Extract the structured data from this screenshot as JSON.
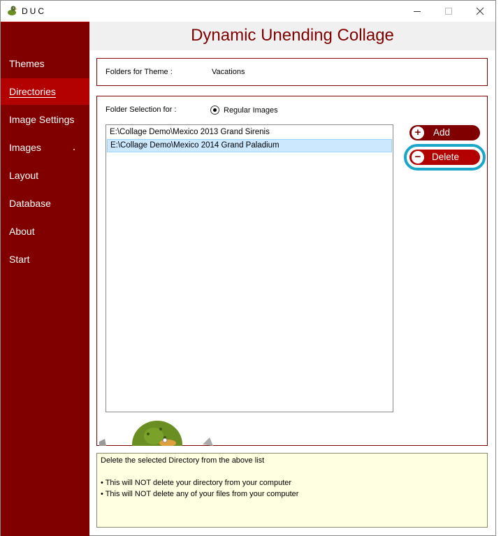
{
  "window": {
    "title": "DUC"
  },
  "header": {
    "title": "Dynamic Unending Collage"
  },
  "sidebar": {
    "items": [
      {
        "label": "Themes"
      },
      {
        "label": "Directories"
      },
      {
        "label": "Image Settings"
      },
      {
        "label": "Images"
      },
      {
        "label": "Layout"
      },
      {
        "label": "Database"
      },
      {
        "label": "About"
      },
      {
        "label": "Start"
      }
    ],
    "active_index": 1
  },
  "theme": {
    "label": "Folders for Theme :",
    "value": "Vacations"
  },
  "folder_selection": {
    "label": "Folder Selection for :",
    "radio_label": "Regular Images",
    "radio_checked": true,
    "items": [
      "E:\\Collage Demo\\Mexico 2013 Grand Sirenis",
      "E:\\Collage Demo\\Mexico 2014 Grand Paladium"
    ],
    "selected_index": 1
  },
  "buttons": {
    "add_label": "Add",
    "delete_label": "Delete"
  },
  "help": {
    "title": "Delete the selected Directory from the above list",
    "bullets": [
      "• This will NOT delete your directory from your computer",
      "• This will NOT delete any of your files from your computer"
    ]
  },
  "colors": {
    "sidebar": "#800000",
    "active": "#b30000",
    "title": "#7f0000",
    "focus": "#1aa6c9",
    "help_bg": "#ffffe1"
  }
}
